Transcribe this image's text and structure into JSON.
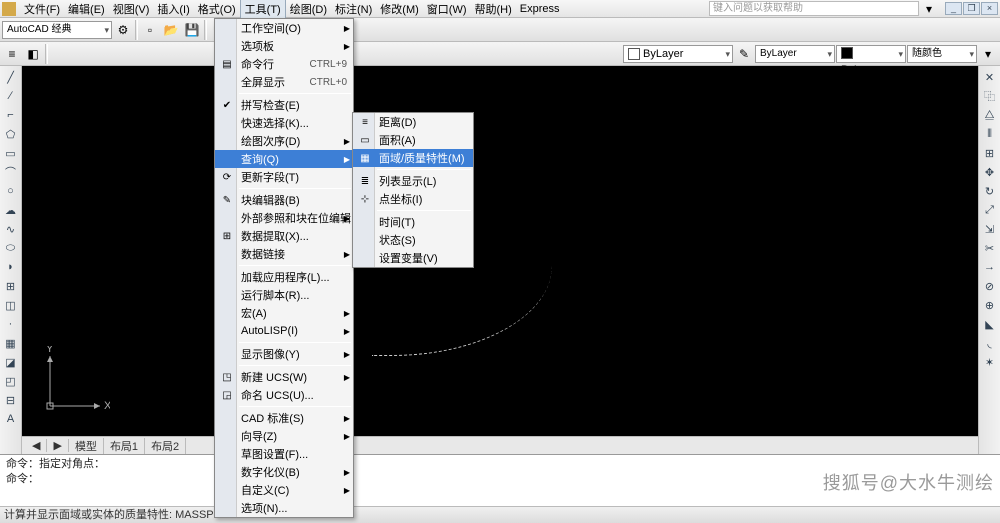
{
  "menubar": {
    "items": [
      "文件(F)",
      "编辑(E)",
      "视图(V)",
      "插入(I)",
      "格式(O)",
      "工具(T)",
      "绘图(D)",
      "标注(N)",
      "修改(M)",
      "窗口(W)",
      "帮助(H)",
      "Express"
    ],
    "search_placeholder": "键入问题以获取帮助",
    "win_btns": [
      "_",
      "❐",
      "×"
    ]
  },
  "toolbar1": {
    "style_combo": "AutoCAD 经典"
  },
  "toolbar2": {
    "layer_combo": "ByLayer",
    "linetype_combo": "ByLayer",
    "color_combo": "ByLayer",
    "color_combo2": "随颜色"
  },
  "dropdown": {
    "groups": [
      [
        {
          "label": "工作空间(O)",
          "icon": "",
          "arrow": true
        },
        {
          "label": "选项板",
          "arrow": true
        },
        {
          "label": "命令行",
          "icon": "▤",
          "shortcut": "CTRL+9"
        },
        {
          "label": "全屏显示",
          "shortcut": "CTRL+0"
        }
      ],
      [
        {
          "label": "拼写检查(E)",
          "icon": "✔"
        },
        {
          "label": "快速选择(K)...",
          "icon": ""
        },
        {
          "label": "绘图次序(D)",
          "arrow": true
        },
        {
          "label": "查询(Q)",
          "arrow": true,
          "sel": true
        },
        {
          "label": "更新字段(T)",
          "icon": "⟳"
        }
      ],
      [
        {
          "label": "块编辑器(B)",
          "icon": "✎"
        },
        {
          "label": "外部参照和块在位编辑",
          "arrow": true
        },
        {
          "label": "数据提取(X)...",
          "icon": "⊞"
        },
        {
          "label": "数据链接",
          "arrow": true
        }
      ],
      [
        {
          "label": "加载应用程序(L)..."
        },
        {
          "label": "运行脚本(R)..."
        },
        {
          "label": "宏(A)",
          "arrow": true
        },
        {
          "label": "AutoLISP(I)",
          "arrow": true
        }
      ],
      [
        {
          "label": "显示图像(Y)",
          "arrow": true
        }
      ],
      [
        {
          "label": "新建 UCS(W)",
          "icon": "◳",
          "arrow": true
        },
        {
          "label": "命名 UCS(U)...",
          "icon": "◲"
        }
      ],
      [
        {
          "label": "CAD 标准(S)",
          "arrow": true
        },
        {
          "label": "向导(Z)",
          "arrow": true
        },
        {
          "label": "草图设置(F)..."
        },
        {
          "label": "数字化仪(B)",
          "arrow": true
        },
        {
          "label": "自定义(C)",
          "arrow": true
        },
        {
          "label": "选项(N)..."
        }
      ]
    ]
  },
  "submenu": {
    "groups": [
      [
        {
          "label": "距离(D)",
          "icon": "≡"
        },
        {
          "label": "面积(A)",
          "icon": "▭"
        },
        {
          "label": "面域/质量特性(M)",
          "icon": "▦",
          "sel": true
        }
      ],
      [
        {
          "label": "列表显示(L)",
          "icon": "≣"
        },
        {
          "label": "点坐标(I)",
          "icon": "⊹"
        }
      ],
      [
        {
          "label": "时间(T)"
        },
        {
          "label": "状态(S)"
        },
        {
          "label": "设置变量(V)"
        }
      ]
    ]
  },
  "tabs": {
    "items": [
      "模型",
      "布局1",
      "布局2"
    ],
    "nav": [
      "◀",
      "▶",
      "▶|"
    ]
  },
  "cmd": {
    "line1": "命令：指定对角点：",
    "line2": "命令："
  },
  "status": {
    "text": "计算并显示面域或实体的质量特性:  MASSPROP"
  },
  "ucs": {
    "x": "X",
    "y": "Y"
  },
  "watermark": "搜狐号@大水牛测绘"
}
